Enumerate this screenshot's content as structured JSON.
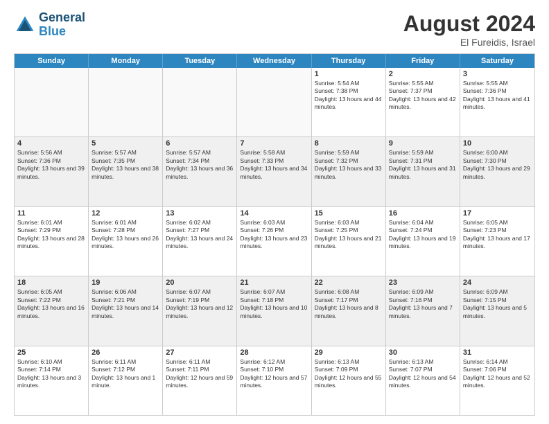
{
  "header": {
    "logo_line1": "General",
    "logo_line2": "Blue",
    "month_year": "August 2024",
    "location": "El Fureidis, Israel"
  },
  "days_of_week": [
    "Sunday",
    "Monday",
    "Tuesday",
    "Wednesday",
    "Thursday",
    "Friday",
    "Saturday"
  ],
  "weeks": [
    [
      {
        "day": "",
        "empty": true
      },
      {
        "day": "",
        "empty": true
      },
      {
        "day": "",
        "empty": true
      },
      {
        "day": "",
        "empty": true
      },
      {
        "day": "1",
        "sunrise": "5:54 AM",
        "sunset": "7:38 PM",
        "daylight": "13 hours and 44 minutes."
      },
      {
        "day": "2",
        "sunrise": "5:55 AM",
        "sunset": "7:37 PM",
        "daylight": "13 hours and 42 minutes."
      },
      {
        "day": "3",
        "sunrise": "5:55 AM",
        "sunset": "7:36 PM",
        "daylight": "13 hours and 41 minutes."
      }
    ],
    [
      {
        "day": "4",
        "sunrise": "5:56 AM",
        "sunset": "7:36 PM",
        "daylight": "13 hours and 39 minutes."
      },
      {
        "day": "5",
        "sunrise": "5:57 AM",
        "sunset": "7:35 PM",
        "daylight": "13 hours and 38 minutes."
      },
      {
        "day": "6",
        "sunrise": "5:57 AM",
        "sunset": "7:34 PM",
        "daylight": "13 hours and 36 minutes."
      },
      {
        "day": "7",
        "sunrise": "5:58 AM",
        "sunset": "7:33 PM",
        "daylight": "13 hours and 34 minutes."
      },
      {
        "day": "8",
        "sunrise": "5:59 AM",
        "sunset": "7:32 PM",
        "daylight": "13 hours and 33 minutes."
      },
      {
        "day": "9",
        "sunrise": "5:59 AM",
        "sunset": "7:31 PM",
        "daylight": "13 hours and 31 minutes."
      },
      {
        "day": "10",
        "sunrise": "6:00 AM",
        "sunset": "7:30 PM",
        "daylight": "13 hours and 29 minutes."
      }
    ],
    [
      {
        "day": "11",
        "sunrise": "6:01 AM",
        "sunset": "7:29 PM",
        "daylight": "13 hours and 28 minutes."
      },
      {
        "day": "12",
        "sunrise": "6:01 AM",
        "sunset": "7:28 PM",
        "daylight": "13 hours and 26 minutes."
      },
      {
        "day": "13",
        "sunrise": "6:02 AM",
        "sunset": "7:27 PM",
        "daylight": "13 hours and 24 minutes."
      },
      {
        "day": "14",
        "sunrise": "6:03 AM",
        "sunset": "7:26 PM",
        "daylight": "13 hours and 23 minutes."
      },
      {
        "day": "15",
        "sunrise": "6:03 AM",
        "sunset": "7:25 PM",
        "daylight": "13 hours and 21 minutes."
      },
      {
        "day": "16",
        "sunrise": "6:04 AM",
        "sunset": "7:24 PM",
        "daylight": "13 hours and 19 minutes."
      },
      {
        "day": "17",
        "sunrise": "6:05 AM",
        "sunset": "7:23 PM",
        "daylight": "13 hours and 17 minutes."
      }
    ],
    [
      {
        "day": "18",
        "sunrise": "6:05 AM",
        "sunset": "7:22 PM",
        "daylight": "13 hours and 16 minutes."
      },
      {
        "day": "19",
        "sunrise": "6:06 AM",
        "sunset": "7:21 PM",
        "daylight": "13 hours and 14 minutes."
      },
      {
        "day": "20",
        "sunrise": "6:07 AM",
        "sunset": "7:19 PM",
        "daylight": "13 hours and 12 minutes."
      },
      {
        "day": "21",
        "sunrise": "6:07 AM",
        "sunset": "7:18 PM",
        "daylight": "13 hours and 10 minutes."
      },
      {
        "day": "22",
        "sunrise": "6:08 AM",
        "sunset": "7:17 PM",
        "daylight": "13 hours and 8 minutes."
      },
      {
        "day": "23",
        "sunrise": "6:09 AM",
        "sunset": "7:16 PM",
        "daylight": "13 hours and 7 minutes."
      },
      {
        "day": "24",
        "sunrise": "6:09 AM",
        "sunset": "7:15 PM",
        "daylight": "13 hours and 5 minutes."
      }
    ],
    [
      {
        "day": "25",
        "sunrise": "6:10 AM",
        "sunset": "7:14 PM",
        "daylight": "13 hours and 3 minutes."
      },
      {
        "day": "26",
        "sunrise": "6:11 AM",
        "sunset": "7:12 PM",
        "daylight": "13 hours and 1 minute."
      },
      {
        "day": "27",
        "sunrise": "6:11 AM",
        "sunset": "7:11 PM",
        "daylight": "12 hours and 59 minutes."
      },
      {
        "day": "28",
        "sunrise": "6:12 AM",
        "sunset": "7:10 PM",
        "daylight": "12 hours and 57 minutes."
      },
      {
        "day": "29",
        "sunrise": "6:13 AM",
        "sunset": "7:09 PM",
        "daylight": "12 hours and 55 minutes."
      },
      {
        "day": "30",
        "sunrise": "6:13 AM",
        "sunset": "7:07 PM",
        "daylight": "12 hours and 54 minutes."
      },
      {
        "day": "31",
        "sunrise": "6:14 AM",
        "sunset": "7:06 PM",
        "daylight": "12 hours and 52 minutes."
      }
    ]
  ]
}
